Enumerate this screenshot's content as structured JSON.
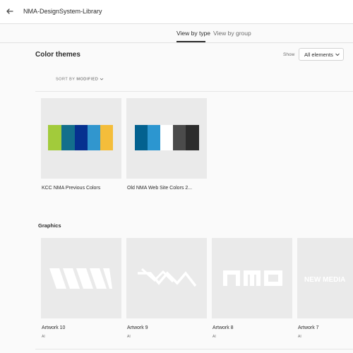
{
  "header": {
    "back_icon": "arrow-left-icon",
    "library_title": "NMA-DesignSystem-Library"
  },
  "view_tabs": [
    {
      "label": "View by type",
      "active": true
    },
    {
      "label": "View by group",
      "active": false
    }
  ],
  "color_themes": {
    "title": "Color themes",
    "show_label": "Show",
    "show_value": "All elements",
    "sort_label": "SORT BY",
    "sort_value": "MODIFIED",
    "items": [
      {
        "name": "KCC NMA Previous Colors",
        "colors": [
          "#a2cb3b",
          "#136f8c",
          "#06318f",
          "#3196ce",
          "#f4bd3a"
        ]
      },
      {
        "name": "Old NMA Web Site Colors 2...",
        "colors": [
          "#03618f",
          "#2c96d0",
          "#ffffff",
          "#4b4b4b",
          "#2c2c2c"
        ]
      }
    ]
  },
  "graphics": {
    "title": "Graphics",
    "items": [
      {
        "name": "Artwork 10",
        "type": "AI"
      },
      {
        "name": "Artwork 9",
        "type": "AI"
      },
      {
        "name": "Artwork 8",
        "type": "AI"
      },
      {
        "name": "Artwork 7",
        "type": "AI"
      }
    ],
    "artwork7_text": "NEW MEDIA"
  }
}
